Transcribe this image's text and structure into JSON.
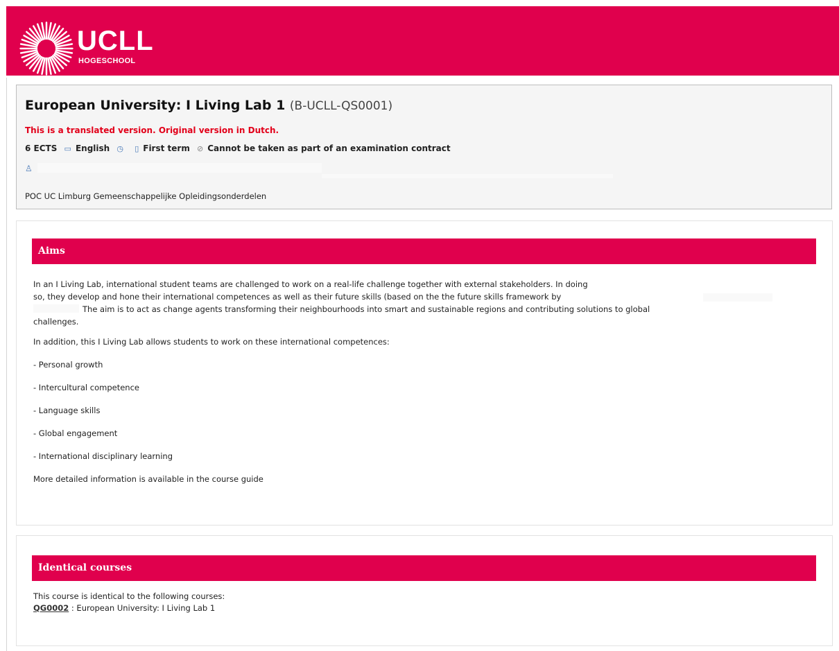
{
  "banner": {
    "logo_title": "UCLL",
    "logo_sub": "HOGESCHOOL"
  },
  "course": {
    "title": "European University: I Living Lab 1",
    "code": "(B-UCLL-QS0001)",
    "translated_note": "This is a translated version. Original version in Dutch.",
    "ects": "6 ECTS",
    "language": "English",
    "term": "First term",
    "exam_contract": "Cannot be taken as part of an examination contract",
    "faculty": "POC UC Limburg Gemeenschappelijke Opleidingsonderdelen"
  },
  "icons": {
    "language": "speech-bubble-icon",
    "clock": "clock-icon",
    "term": "calendar-icon",
    "contract": "forbidden-icon",
    "coordinator": "person-icon"
  },
  "colors": {
    "brand": "#e0004d",
    "notice": "#e2001a",
    "icon": "#4a7ab8"
  },
  "aims": {
    "title": "Aims",
    "line1": "In an I Living Lab, international student teams are challenged  to work on a real-life challenge together with external stakeholders. In doing",
    "line2": "so, they develop and hone their international competences as well as their future skills (based on the the future skills framework by",
    "line3": "The aim is to act as change agents transforming their neighbourhoods into smart and sustainable regions and contributing solutions to global",
    "line4": "challenges.",
    "intro": "In addition, this I Living Lab allows students to work on these international competences:",
    "items": [
      "- Personal growth",
      "- Intercultural competence",
      "- Language skills",
      "- Global engagement",
      "- International disciplinary learning"
    ],
    "more_info": "More detailed information is available in the course guide"
  },
  "identical": {
    "title": "Identical courses",
    "intro": "This course is identical to the following courses:",
    "course_code": "QG0002",
    "course_sep": " : ",
    "course_name": "European University: I Living Lab 1"
  }
}
